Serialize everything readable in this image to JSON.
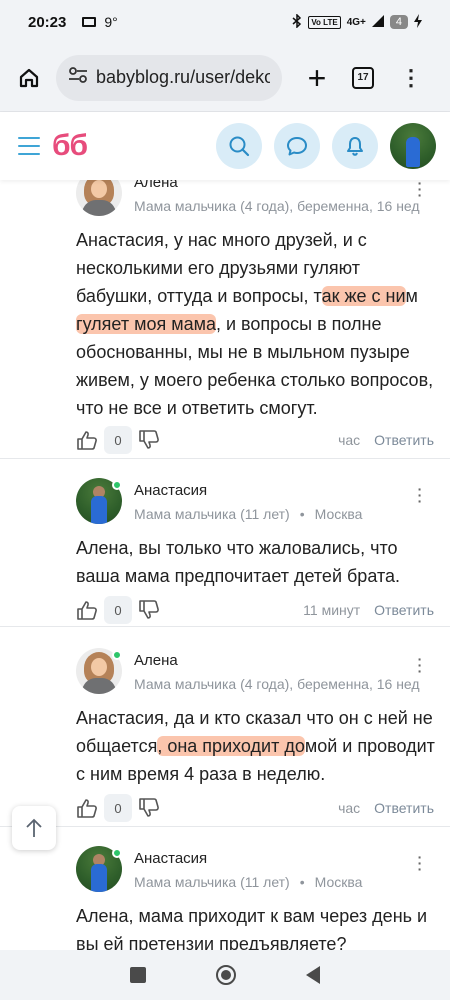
{
  "status_bar": {
    "time": "20:23",
    "temperature": "9°",
    "network_badge": "Vo LTE",
    "signal": "4G+",
    "battery": "4"
  },
  "browser": {
    "url": "babyblog.ru/user/deko",
    "tab_count": "17"
  },
  "site": {
    "logo": "бб"
  },
  "comments": [
    {
      "author": "Алена",
      "meta": "Мама мальчика (4 года), беременна, 16 нед",
      "text_parts": [
        "Анастасия",
        ", у нас много друзей, и с несколькими его друзьями гуляют бабушки, оттуда и вопросы, т",
        "ак же с ни",
        "м ",
        "гуляет моя мама",
        ", и вопросы в полне обоснованны, мы не в мыльном пузыре живем, у моего ребенка столько вопросов, что не все и ответить смогут."
      ],
      "likes": "0",
      "time": "час",
      "reply_label": "Ответить"
    },
    {
      "author": "Анастасия",
      "meta": "Мама мальчика (11 лет)",
      "location": "Москва",
      "text_parts": [
        "Алена",
        ", вы только что жаловались, что ваша мама предпочитает детей брата."
      ],
      "likes": "0",
      "time": "11 минут",
      "reply_label": "Ответить"
    },
    {
      "author": "Алена",
      "meta": "Мама мальчика (4 года), беременна, 16 нед",
      "text_parts": [
        "Анастасия",
        ", да и кто сказал что он с ней не общается",
        ", она приходит до",
        "мой и проводит с ним время 4 раза в неделю."
      ],
      "likes": "0",
      "time": "час",
      "reply_label": "Ответить"
    },
    {
      "author": "Анастасия",
      "meta": "Мама мальчика (11 лет)",
      "location": "Москва",
      "text_parts": [
        "Алена",
        ", мама приходит к вам через день и вы ей претензии предъявляете?"
      ]
    }
  ],
  "colors": {
    "logo": "#e74c7c",
    "accent_blue": "#3fa5d6",
    "icon_circle_bg": "#d9ecf7",
    "online": "#2ec56a",
    "highlight": "#f79669"
  }
}
